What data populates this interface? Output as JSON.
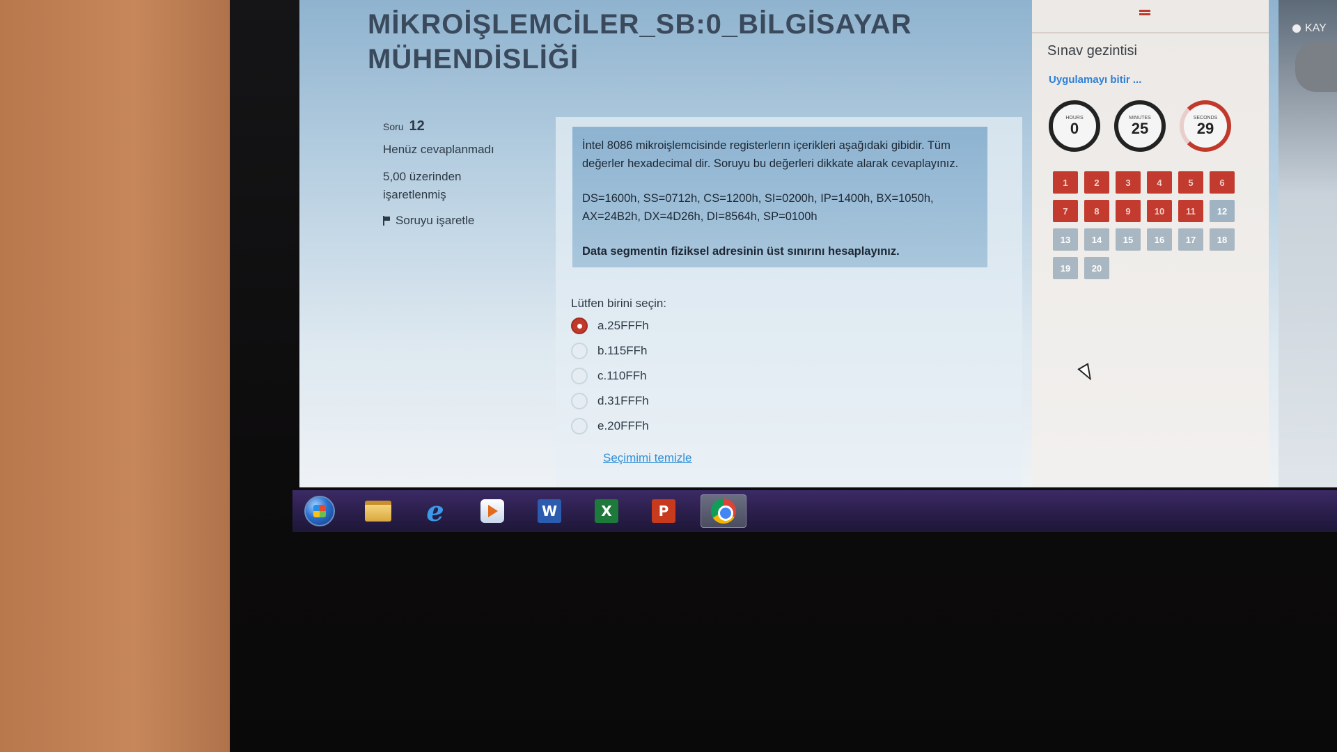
{
  "page": {
    "title": "MİKROİŞLEMCİLER_SB:0_BİLGİSAYAR MÜHENDİSLİĞİ"
  },
  "question_info": {
    "label": "Soru",
    "number": "12",
    "status": "Henüz cevaplanmadı",
    "grade": "5,00 üzerinden işaretlenmiş",
    "flag_label": "Soruyu işaretle"
  },
  "question": {
    "paragraphs": [
      "İntel 8086 mikroişlemcisinde registerlerın içerikleri aşağıdaki gibidir. Tüm değerler hexadecimal dir. Soruyu bu değerleri dikkate alarak cevaplayınız.",
      "DS=1600h, SS=0712h, CS=1200h, SI=0200h, IP=1400h, BX=1050h, AX=24B2h, DX=4D26h, DI=8564h, SP=0100h",
      "Data segmentin fiziksel adresinin üst sınırını hesaplayınız."
    ],
    "prompt": "Lütfen birini seçin:",
    "answers": [
      {
        "label": "a.25FFFh",
        "selected": true
      },
      {
        "label": "b.115FFh",
        "selected": false
      },
      {
        "label": "c.110FFh",
        "selected": false
      },
      {
        "label": "d.31FFFh",
        "selected": false
      },
      {
        "label": "e.20FFFh",
        "selected": false
      }
    ],
    "clear_label": "Seçimimi temizle"
  },
  "nav": {
    "title": "Sınav gezintisi",
    "finish_label": "Uygulamayı bitir ...",
    "timers": [
      {
        "label": "HOURS",
        "value": "0"
      },
      {
        "label": "MINUTES",
        "value": "25"
      },
      {
        "label": "SECONDS",
        "value": "29"
      }
    ],
    "questions": [
      {
        "n": "1",
        "state": "answered"
      },
      {
        "n": "2",
        "state": "answered"
      },
      {
        "n": "3",
        "state": "answered"
      },
      {
        "n": "4",
        "state": "answered"
      },
      {
        "n": "5",
        "state": "answered"
      },
      {
        "n": "6",
        "state": "answered"
      },
      {
        "n": "7",
        "state": "answered"
      },
      {
        "n": "8",
        "state": "answered"
      },
      {
        "n": "9",
        "state": "answered"
      },
      {
        "n": "10",
        "state": "answered"
      },
      {
        "n": "11",
        "state": "answered"
      },
      {
        "n": "12",
        "state": "current"
      },
      {
        "n": "13",
        "state": "unanswered"
      },
      {
        "n": "14",
        "state": "unanswered"
      },
      {
        "n": "15",
        "state": "unanswered"
      },
      {
        "n": "16",
        "state": "unanswered"
      },
      {
        "n": "17",
        "state": "unanswered"
      },
      {
        "n": "18",
        "state": "unanswered"
      },
      {
        "n": "19",
        "state": "unanswered"
      },
      {
        "n": "20",
        "state": "unanswered"
      }
    ]
  },
  "side": {
    "record_label": "KAY"
  },
  "taskbar": {
    "items": [
      "start-orb-icon",
      "file-explorer-icon",
      "internet-explorer-icon",
      "media-player-icon",
      "word-icon",
      "excel-icon",
      "powerpoint-icon",
      "chrome-icon"
    ],
    "ie_glyph": "e",
    "word_glyph": "W",
    "excel_glyph": "X",
    "ppt_glyph": "P"
  },
  "colors": {
    "accent_red": "#c23b2e",
    "link_blue": "#2f8fd6"
  }
}
